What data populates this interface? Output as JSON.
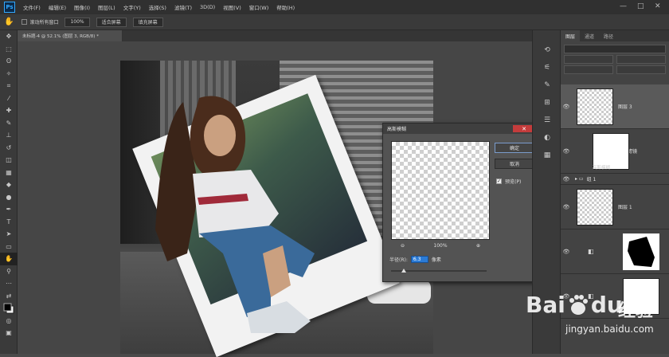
{
  "app": {
    "logo": "Ps",
    "menus": [
      "文件(F)",
      "编辑(E)",
      "图像(I)",
      "图层(L)",
      "文字(Y)",
      "选择(S)",
      "滤镜(T)",
      "3D(D)",
      "视图(V)",
      "窗口(W)",
      "帮助(H)"
    ],
    "window_controls": [
      "—",
      "□",
      "✕"
    ]
  },
  "options_bar": {
    "scroll_all_label": "滚动所有窗口",
    "zoom_value": "100%",
    "fit_screen_label": "适合屏幕",
    "fill_screen_label": "填充屏幕"
  },
  "document": {
    "tab_title": "未标题-4 @ 52.1% (图层 3, RGB/8) *"
  },
  "dialog": {
    "title": "高斯模糊",
    "close": "✕",
    "ok_label": "确定",
    "cancel_label": "取消",
    "preview_label": "预览(P)",
    "preview_checked": true,
    "zoom_out": "⊖",
    "zoom_in": "⊕",
    "zoom_value": "100%",
    "radius_label": "半径(R):",
    "radius_value": "6.3",
    "radius_unit": "像素",
    "slider_fraction": 0.13
  },
  "layers_panel": {
    "tabs": [
      "图层",
      "通道",
      "路径"
    ],
    "layers": [
      {
        "name": "图层 3",
        "selected": true,
        "thumb": "checker"
      },
      {
        "name": "智能滤镜",
        "thumb": "white",
        "sub": "高斯模糊"
      },
      {
        "name": "组 1",
        "group": true
      },
      {
        "name": "图层 1",
        "thumb": "checker"
      }
    ]
  },
  "watermark": {
    "brand_left": "Bai",
    "brand_right": "du",
    "brand_cn": "经验",
    "url": "jingyan.baidu.com"
  },
  "icons": {
    "visibility": "eye-icon",
    "hand": "hand-tool-icon"
  }
}
